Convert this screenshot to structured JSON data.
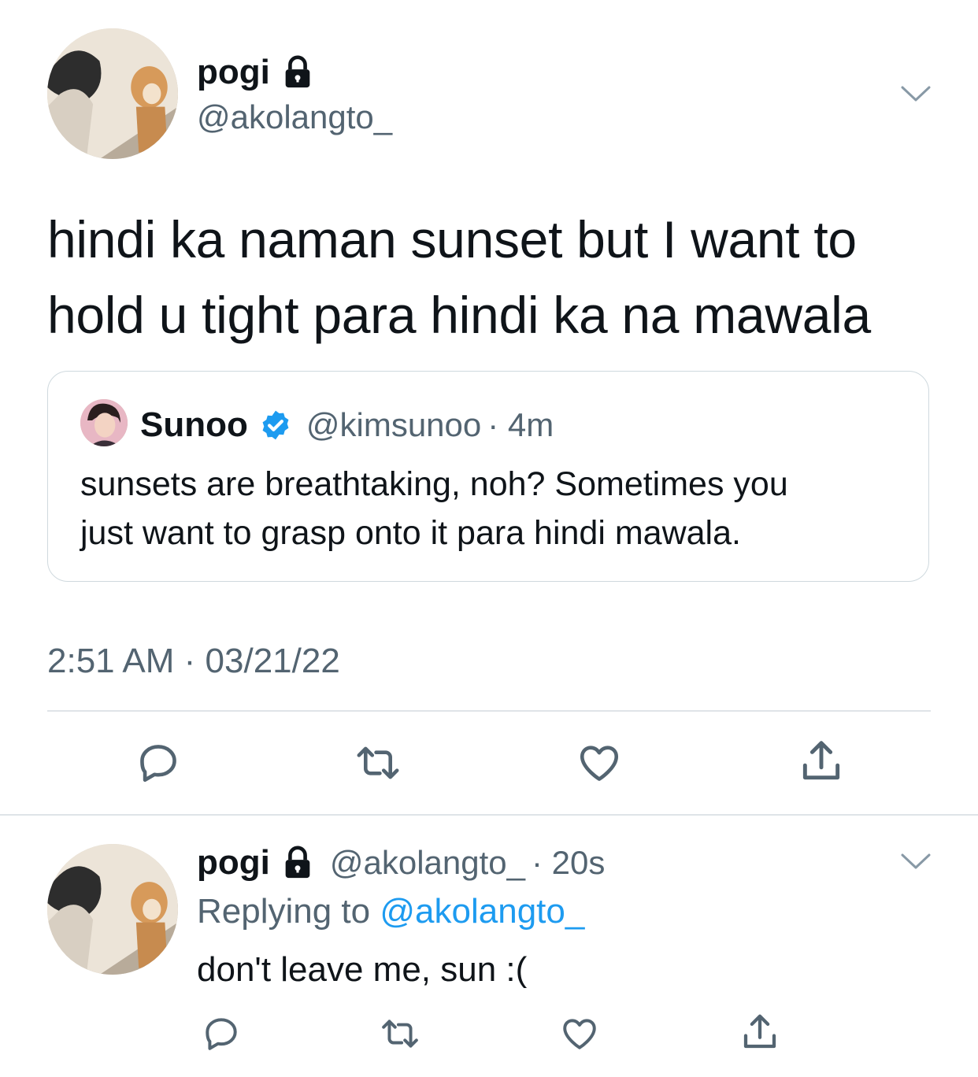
{
  "main_tweet": {
    "name": "pogi",
    "handle": "@akolangto_",
    "text_line1": "hindi ka naman sunset but I want to",
    "text_line2": "hold u tight para hindi ka na mawala",
    "timestamp": "2:51 AM · 03/21/22"
  },
  "quoted_tweet": {
    "name": "Sunoo",
    "handle": "@kimsunoo",
    "time": "· 4m",
    "text_line1": "sunsets are breathtaking, noh? Sometimes you",
    "text_line2": "just want to grasp onto it para hindi mawala."
  },
  "reply_tweet": {
    "name": "pogi",
    "handle": "@akolangto_",
    "time": "· 20s",
    "replying_prefix": "Replying to",
    "replying_handle": "@akolangto_",
    "text": "don't leave me, sun :("
  },
  "icons": {
    "lock": "lock-icon",
    "verified": "verified-badge-icon",
    "chevron": "chevron-down-icon",
    "reply": "reply-icon",
    "retweet": "retweet-icon",
    "like": "like-icon",
    "share": "share-icon"
  },
  "colors": {
    "text": "#0f1419",
    "secondary": "#536471",
    "link": "#1d9bf0",
    "divider": "#dfe4e8",
    "verified": "#1d9bf0"
  }
}
